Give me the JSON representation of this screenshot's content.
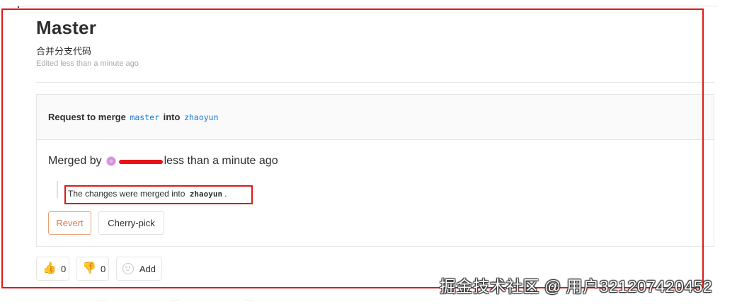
{
  "page": {
    "title": "Master",
    "description": "合并分支代码",
    "edited": "Edited less than a minute ago"
  },
  "merge_request": {
    "prefix": "Request to merge",
    "source_branch": "master",
    "into_label": "into",
    "target_branch": "zhaoyun"
  },
  "merged": {
    "by_label": "Merged by",
    "time": "less than a minute ago",
    "message_prefix": "The changes were merged into",
    "message_branch": "zhaoyun",
    "message_suffix": "."
  },
  "actions": {
    "revert_label": "Revert",
    "cherry_pick_label": "Cherry-pick"
  },
  "reactions": {
    "thumbs_up_count": "0",
    "thumbs_down_count": "0",
    "add_label": "Add"
  },
  "watermark": {
    "text": "掘金技术社区 @ 用户3212074204​52"
  },
  "colors": {
    "annotation_red": "#e01818",
    "branch_blue": "#1f78d1",
    "revert_orange": "#e07a3f",
    "thumb_yellow": "#f2b01e"
  }
}
